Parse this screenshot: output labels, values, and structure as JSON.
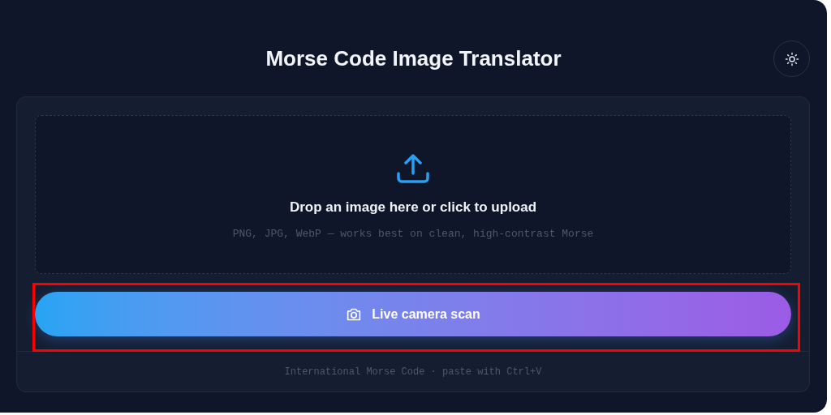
{
  "header": {
    "title": "Morse Code Image Translator"
  },
  "dropzone": {
    "title": "Drop an image here or click to upload",
    "hint": "PNG, JPG, WebP — works best on clean, high-contrast Morse"
  },
  "camera_button": {
    "label": "Live camera scan",
    "highlighted": true
  },
  "footer": {
    "text": "International Morse Code · paste with Ctrl+V"
  }
}
